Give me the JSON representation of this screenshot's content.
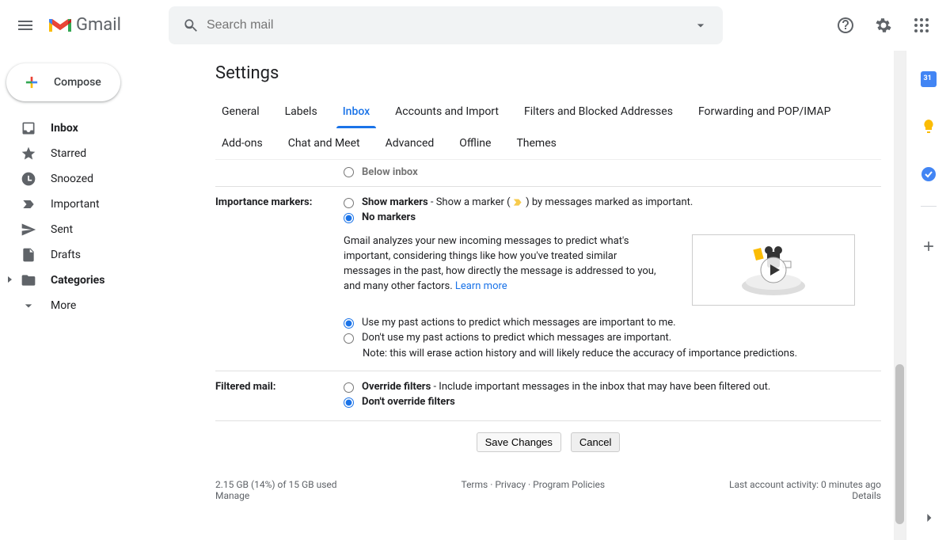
{
  "header": {
    "logo_text": "Gmail",
    "search_placeholder": "Search mail"
  },
  "sidebar": {
    "compose": "Compose",
    "items": [
      {
        "label": "Inbox",
        "bold": true
      },
      {
        "label": "Starred",
        "bold": false
      },
      {
        "label": "Snoozed",
        "bold": false
      },
      {
        "label": "Important",
        "bold": false
      },
      {
        "label": "Sent",
        "bold": false
      },
      {
        "label": "Drafts",
        "bold": false
      },
      {
        "label": "Categories",
        "bold": true
      },
      {
        "label": "More",
        "bold": false
      }
    ]
  },
  "page": {
    "title": "Settings",
    "tabs_row1": [
      "General",
      "Labels",
      "Inbox",
      "Accounts and Import",
      "Filters and Blocked Addresses",
      "Forwarding and POP/IMAP"
    ],
    "tabs_row2": [
      "Add-ons",
      "Chat and Meet",
      "Advanced",
      "Offline",
      "Themes"
    ],
    "active_tab": "Inbox"
  },
  "settings": {
    "below_inbox": "Below inbox",
    "importance": {
      "label": "Importance markers:",
      "show_bold": "Show markers",
      "show_rest": " - Show a marker (",
      "show_rest2": ") by messages marked as important.",
      "no_markers": "No markers",
      "selected": "no",
      "explain": "Gmail analyzes your new incoming messages to predict what's important, considering things like how you've treated similar messages in the past, how directly the message is addressed to you, and many other factors. ",
      "learn_more": "Learn more",
      "use_past": "Use my past actions to predict which messages are important to me.",
      "dont_use": "Don't use my past actions to predict which messages are important.",
      "note": "Note: this will erase action history and will likely reduce the accuracy of importance predictions.",
      "past_selected": "use"
    },
    "filtered": {
      "label": "Filtered mail:",
      "override_bold": "Override filters",
      "override_rest": " - Include important messages in the inbox that may have been filtered out.",
      "dont_override": "Don't override filters",
      "selected": "dont"
    },
    "actions": {
      "save": "Save Changes",
      "cancel": "Cancel"
    }
  },
  "footer": {
    "storage": "2.15 GB (14%) of 15 GB used",
    "manage": "Manage",
    "terms": "Terms",
    "privacy": "Privacy",
    "policies": "Program Policies",
    "activity": "Last account activity: 0 minutes ago",
    "details": "Details"
  }
}
